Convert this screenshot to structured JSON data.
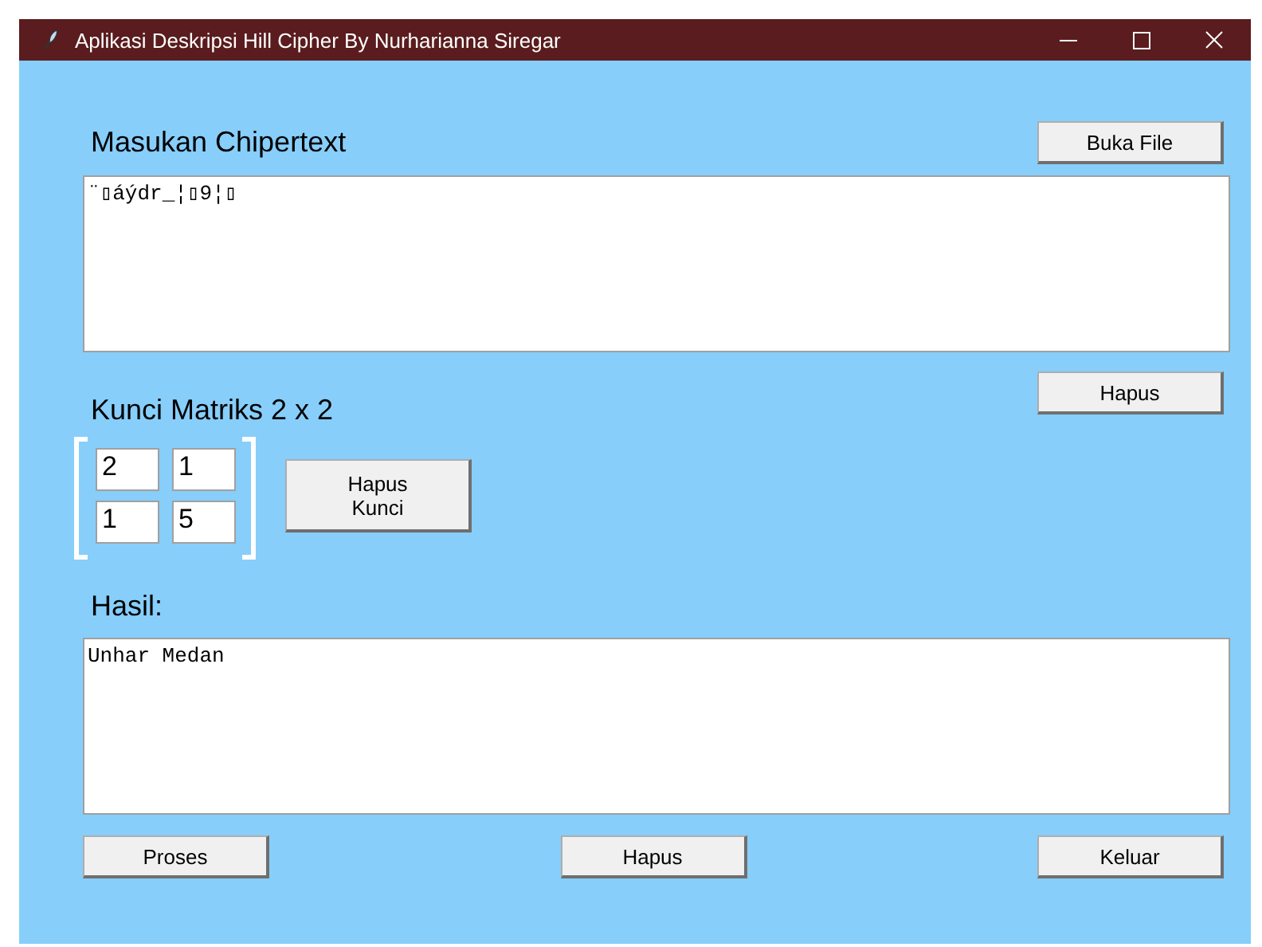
{
  "window": {
    "title": "Aplikasi Deskripsi Hill Cipher By Nurharianna Siregar"
  },
  "ciphertext": {
    "label": "Masukan Chipertext",
    "open_button": "Buka File",
    "value": "¨▯áýdr_¦▯9¦▯",
    "clear_button": "Hapus"
  },
  "key": {
    "label": "Kunci Matriks 2 x 2",
    "cells": [
      "2",
      "1",
      "1",
      "5"
    ],
    "clear_button": "Hapus Kunci"
  },
  "result": {
    "label": "Hasil:",
    "value": "Unhar Medan"
  },
  "buttons": [
    "Proses",
    "Hapus",
    "Keluar"
  ]
}
